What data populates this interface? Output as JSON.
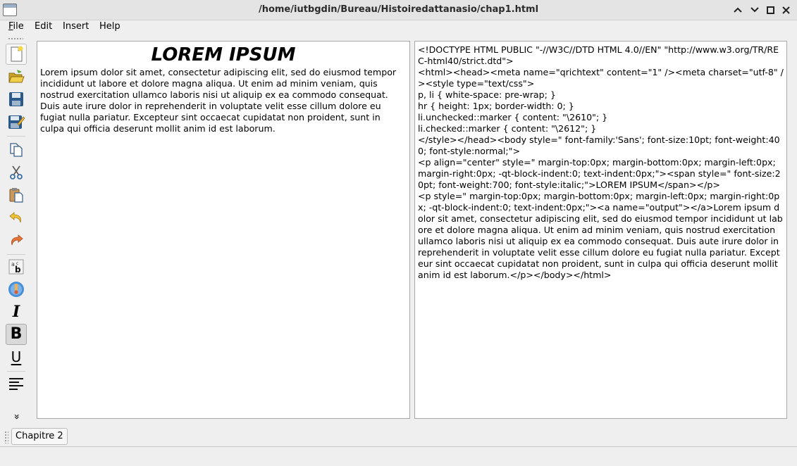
{
  "window": {
    "title": "/home/iutbgdin/Bureau/Histoiredattanasio/chap1.html"
  },
  "menu": {
    "file_first": "F",
    "file_rest": "ile",
    "edit": "Edit",
    "insert": "Insert",
    "help": "Help"
  },
  "toolbar": {
    "italic_glyph": "I",
    "bold_glyph": "B",
    "underline_glyph": "U",
    "overflow_glyph": "»"
  },
  "document": {
    "heading": "LOREM IPSUM",
    "body": "Lorem ipsum dolor sit amet, consectetur adipiscing elit, sed do eiusmod tempor incididunt ut labore et dolore magna aliqua. Ut enim ad minim veniam, quis nostrud exercitation ullamco laboris nisi ut aliquip ex ea commodo consequat. Duis aute irure dolor in reprehenderit in voluptate velit esse cillum dolore eu fugiat nulla pariatur. Excepteur sint occaecat cupidatat non proident, sunt in culpa qui officia deserunt mollit anim id est laborum."
  },
  "source": {
    "html": "<!DOCTYPE HTML PUBLIC \"-//W3C//DTD HTML 4.0//EN\" \"http://www.w3.org/TR/REC-html40/strict.dtd\">\n<html><head><meta name=\"qrichtext\" content=\"1\" /><meta charset=\"utf-8\" /><style type=\"text/css\">\np, li { white-space: pre-wrap; }\nhr { height: 1px; border-width: 0; }\nli.unchecked::marker { content: \"\\2610\"; }\nli.checked::marker { content: \"\\2612\"; }\n</style></head><body style=\" font-family:'Sans'; font-size:10pt; font-weight:400; font-style:normal;\">\n<p align=\"center\" style=\" margin-top:0px; margin-bottom:0px; margin-left:0px; margin-right:0px; -qt-block-indent:0; text-indent:0px;\"><span style=\" font-size:20pt; font-weight:700; font-style:italic;\">LOREM IPSUM</span></p>\n<p style=\" margin-top:0px; margin-bottom:0px; margin-left:0px; margin-right:0px; -qt-block-indent:0; text-indent:0px;\"><a name=\"output\"></a>Lorem ipsum dolor sit amet, consectetur adipiscing elit, sed do eiusmod tempor incididunt ut labore et dolore magna aliqua. Ut enim ad minim veniam, quis nostrud exercitation ullamco laboris nisi ut aliquip ex ea commodo consequat. Duis aute irure dolor in reprehenderit in voluptate velit esse cillum dolore eu fugiat nulla pariatur. Excepteur sint occaecat cupidatat non proident, sunt in culpa qui officia deserunt mollit anim id est laborum.</p></body></html>"
  },
  "tabs": {
    "chapter": "Chapitre 2"
  }
}
